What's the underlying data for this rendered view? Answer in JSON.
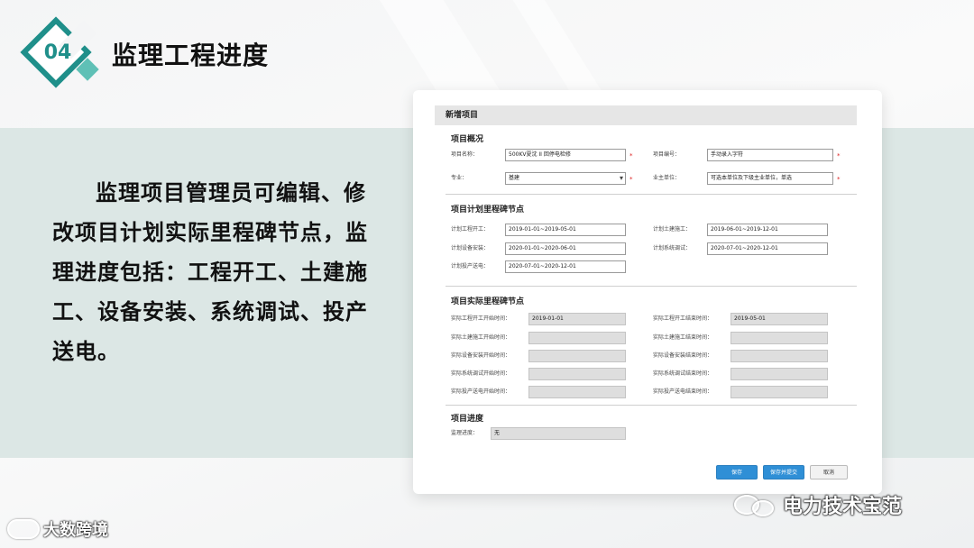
{
  "slide": {
    "badge_number": "04",
    "title": "监理工程进度",
    "body": "监理项目管理员可编辑、修改项目计划实际里程碑节点，监理进度包括：工程开工、土建施工、设备安装、系统调试、投产送电。",
    "accent_color": "#1f8f8a"
  },
  "form": {
    "window_title": "新增项目",
    "overview": {
      "title": "项目概况",
      "project_name_label": "项目名称：",
      "project_name_value": "500KV夏沈 II 回停电检修",
      "project_code_label": "项目编号：",
      "project_code_value": "手动录入字符",
      "specialty_label": "专业：",
      "specialty_value": "基建",
      "owner_label": "业主单位：",
      "owner_value": "可选本单位及下级主业单位，单选"
    },
    "plan": {
      "title": "项目计划里程碑节点",
      "start_label": "计划工程开工：",
      "start_value": "2019-01-01~2019-05-01",
      "civil_label": "计划土建施工：",
      "civil_value": "2019-06-01~2019-12-01",
      "install_label": "计划设备安装：",
      "install_value": "2020-01-01~2020-06-01",
      "debug_label": "计划系统调试：",
      "debug_value": "2020-07-01~2020-12-01",
      "power_label": "计划投产送电：",
      "power_value": "2020-07-01~2020-12-01"
    },
    "actual": {
      "title": "项目实际里程碑节点",
      "rows": [
        {
          "start_label": "实际工程开工开始时间：",
          "start_value": "2019-01-01",
          "end_label": "实际工程开工结束时间：",
          "end_value": "2019-05-01"
        },
        {
          "start_label": "实际土建施工开始时间：",
          "start_value": "",
          "end_label": "实际土建施工结束时间：",
          "end_value": ""
        },
        {
          "start_label": "实际设备安装开始时间：",
          "start_value": "",
          "end_label": "实际设备安装结束时间：",
          "end_value": ""
        },
        {
          "start_label": "实际系统调试开始时间：",
          "start_value": "",
          "end_label": "实际系统调试结束时间：",
          "end_value": ""
        },
        {
          "start_label": "实际投产送电开始时间：",
          "start_value": "",
          "end_label": "实际投产送电结束时间：",
          "end_value": ""
        }
      ]
    },
    "progress": {
      "title": "项目进度",
      "label": "监理进度：",
      "value": "无"
    },
    "buttons": {
      "save": "保存",
      "save_submit": "保存并提交",
      "cancel": "取消"
    }
  },
  "watermarks": {
    "left": "大数跨境",
    "right": "电力技术宝范"
  }
}
